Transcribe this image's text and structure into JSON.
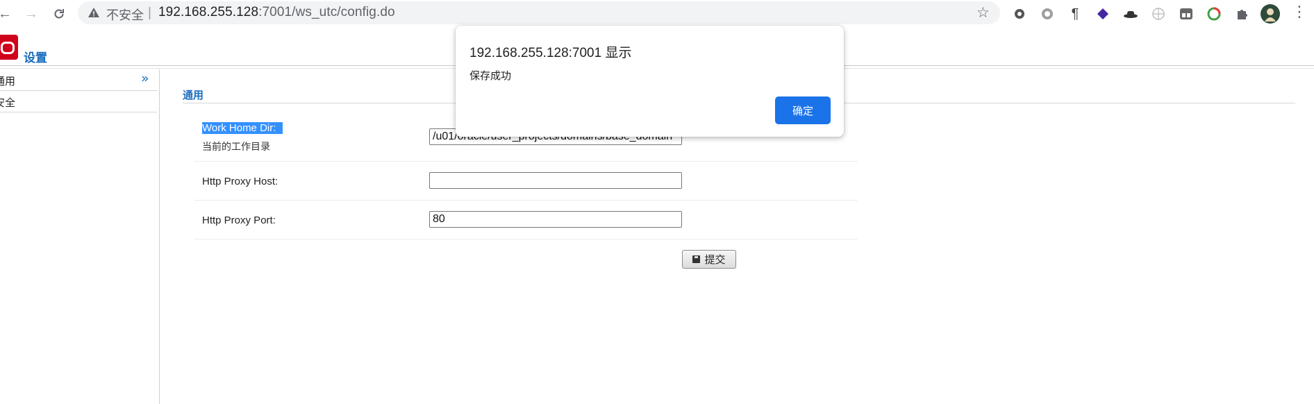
{
  "browser": {
    "security_label": "不安全",
    "separator": "|",
    "url_host": "192.168.255.128",
    "url_rest": ":7001/ws_utc/config.do",
    "extensions": [
      "gear-extension-icon",
      "circle-extension-icon",
      "pilcrow-extension-icon",
      "layers-extension-icon",
      "hat-extension-icon",
      "globe-extension-icon",
      "window-extension-icon",
      "sync-extension-icon",
      "puzzle-icon",
      "profile-avatar"
    ]
  },
  "header": {
    "title": "设置"
  },
  "sidebar": {
    "items": [
      {
        "label": "通用"
      },
      {
        "label": "安全"
      }
    ]
  },
  "main": {
    "section_title": "通用",
    "fields": [
      {
        "label": "Work Home Dir:",
        "description": "当前的工作目录",
        "value": "/u01/oracle/user_projects/domains/base_domain"
      },
      {
        "label": "Http Proxy Host:",
        "value": ""
      },
      {
        "label": "Http Proxy Port:",
        "value": "80"
      }
    ],
    "submit_label": "提交"
  },
  "dialog": {
    "title": "192.168.255.128:7001 显示",
    "message": "保存成功",
    "ok_label": "确定"
  },
  "colors": {
    "accent": "#1a6dbd",
    "dialog_button": "#1a73e8",
    "selection": "#3390ff",
    "logo": "#d0021b"
  }
}
